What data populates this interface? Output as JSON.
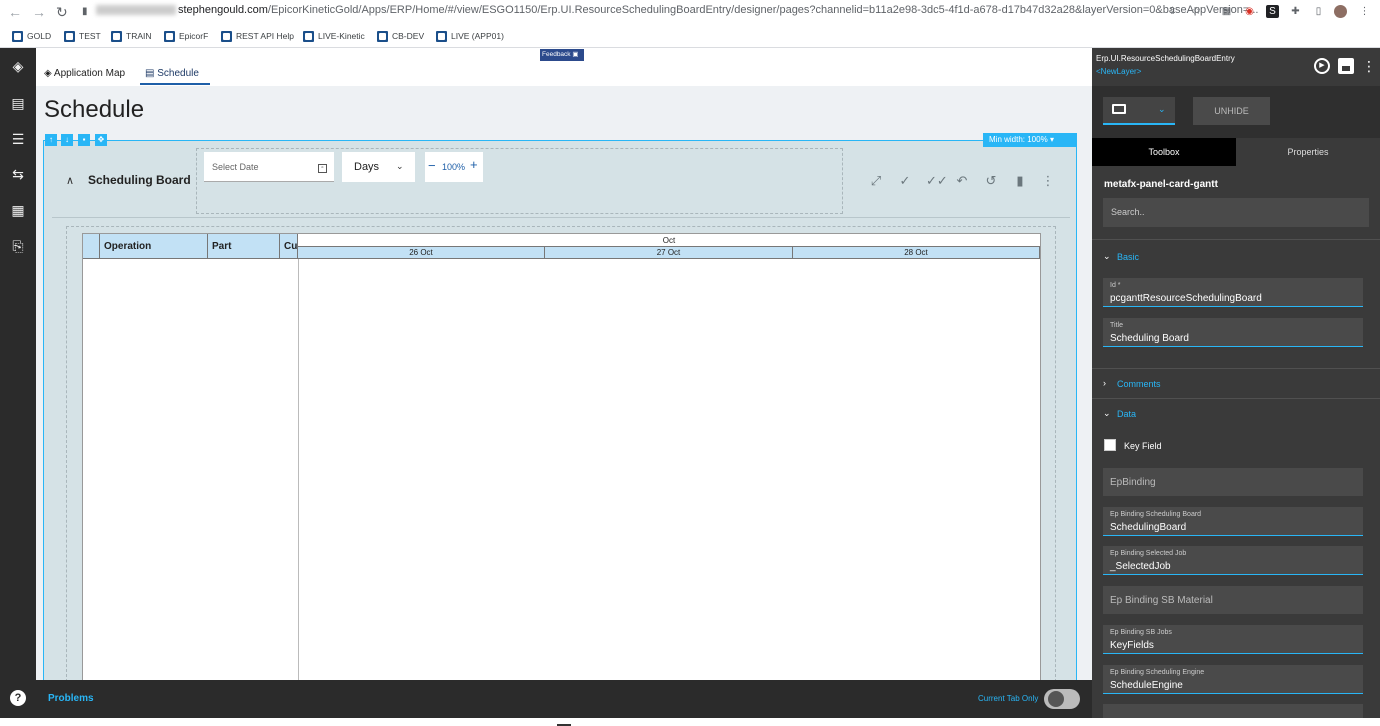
{
  "browser": {
    "url_host": "stephengould.com",
    "url_path": "/EpicorKineticGold/Apps/ERP/Home/#/view/ESGO1150/Erp.UI.ResourceSchedulingBoardEntry/designer/pages?channelid=b11a2e98-3dc5-4f1d-a678-d17b47d32a28&layerVersion=0&baseAppVersion=...",
    "bookmarks": [
      "GOLD",
      "TEST",
      "TRAIN",
      "EpicorF",
      "REST API Help",
      "LIVE-Kinetic",
      "CB-DEV",
      "LIVE (APP01)"
    ]
  },
  "app_tabs": {
    "application_map": "Application Map",
    "schedule": "Schedule"
  },
  "feedback_label": "Feedback",
  "page_title": "Schedule",
  "min_width_label": "Min width: 100%",
  "card": {
    "title": "Scheduling Board",
    "date_placeholder": "Select Date",
    "view_select": "Days",
    "zoom": "100%"
  },
  "gantt": {
    "columns": [
      "Operation",
      "Part",
      "Cus"
    ],
    "month": "Oct",
    "days": [
      "26 Oct",
      "27 Oct",
      "28 Oct"
    ]
  },
  "bottom": {
    "problems": "Problems",
    "current_tab_only": "Current Tab Only"
  },
  "right_panel": {
    "title": "Erp.UI.ResourceSchedulingBoardEntry",
    "layer": "<NewLayer>",
    "unhide": "UNHIDE",
    "tab_toolbox": "Toolbox",
    "tab_properties": "Properties",
    "component": "metafx-panel-card-gantt",
    "search_placeholder": "Search..",
    "sections": {
      "basic": "Basic",
      "comments": "Comments",
      "data": "Data"
    },
    "fields": {
      "id_label": "Id *",
      "id_value": "pcganttResourceSchedulingBoard",
      "title_label": "Title",
      "title_value": "Scheduling Board",
      "key_field": "Key Field",
      "epbinding_placeholder": "EpBinding",
      "epb_sched_label": "Ep Binding Scheduling Board",
      "epb_sched_value": "SchedulingBoard",
      "epb_job_label": "Ep Binding Selected Job",
      "epb_job_value": "_SelectedJob",
      "epb_material_placeholder": "Ep Binding SB Material",
      "epb_jobs_label": "Ep Binding SB Jobs",
      "epb_jobs_value": "KeyFields",
      "epb_engine_label": "Ep Binding Scheduling Engine",
      "epb_engine_value": "ScheduleEngine"
    }
  },
  "colors": {
    "accent": "#29b6f6",
    "dark_panel": "#3a3a3a",
    "nav": "#2b2b2b",
    "gantt_header": "#c2e1f5"
  }
}
